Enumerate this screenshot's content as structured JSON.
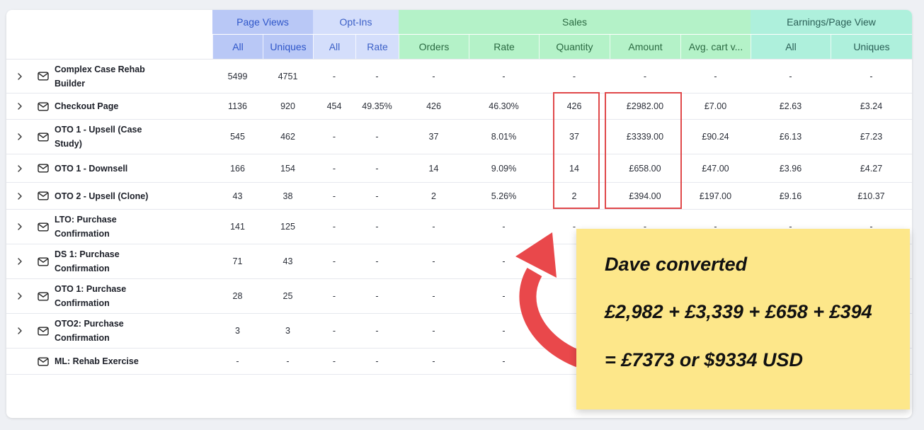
{
  "header": {
    "groups": [
      {
        "label": "Page Views",
        "subs": [
          "All",
          "Uniques"
        ]
      },
      {
        "label": "Opt-Ins",
        "subs": [
          "All",
          "Rate"
        ]
      },
      {
        "label": "Sales",
        "subs": [
          "Orders",
          "Rate",
          "Quantity",
          "Amount",
          "Avg. cart v..."
        ]
      },
      {
        "label": "Earnings/Page View",
        "subs": [
          "All",
          "Uniques"
        ]
      }
    ]
  },
  "rows": [
    {
      "name_lines": [
        "Complex Case Rehab",
        "Builder"
      ],
      "expandable": true,
      "cells": [
        "5499",
        "4751",
        "-",
        "-",
        "-",
        "-",
        "-",
        "-",
        "-",
        "-",
        "-"
      ]
    },
    {
      "name_lines": [
        "Checkout Page"
      ],
      "expandable": true,
      "cells": [
        "1136",
        "920",
        "454",
        "49.35%",
        "426",
        "46.30%",
        "426",
        "£2982.00",
        "£7.00",
        "£2.63",
        "£3.24"
      ]
    },
    {
      "name_lines": [
        "OTO 1 - Upsell (Case",
        "Study)"
      ],
      "expandable": true,
      "cells": [
        "545",
        "462",
        "-",
        "-",
        "37",
        "8.01%",
        "37",
        "£3339.00",
        "£90.24",
        "£6.13",
        "£7.23"
      ]
    },
    {
      "name_lines": [
        "OTO 1 - Downsell"
      ],
      "expandable": true,
      "cells": [
        "166",
        "154",
        "-",
        "-",
        "14",
        "9.09%",
        "14",
        "£658.00",
        "£47.00",
        "£3.96",
        "£4.27"
      ]
    },
    {
      "name_lines": [
        "OTO 2 - Upsell (Clone)"
      ],
      "expandable": true,
      "cells": [
        "43",
        "38",
        "-",
        "-",
        "2",
        "5.26%",
        "2",
        "£394.00",
        "£197.00",
        "£9.16",
        "£10.37"
      ]
    },
    {
      "name_lines": [
        "LTO: Purchase",
        "Confirmation"
      ],
      "expandable": true,
      "cells": [
        "141",
        "125",
        "-",
        "-",
        "-",
        "-",
        "-",
        "-",
        "-",
        "-",
        "-"
      ]
    },
    {
      "name_lines": [
        "DS 1: Purchase",
        "Confirmation"
      ],
      "expandable": true,
      "cells": [
        "71",
        "43",
        "-",
        "-",
        "-",
        "-",
        "",
        "",
        "",
        "",
        ""
      ]
    },
    {
      "name_lines": [
        "OTO 1: Purchase",
        "Confirmation"
      ],
      "expandable": true,
      "cells": [
        "28",
        "25",
        "-",
        "-",
        "-",
        "-",
        "",
        "",
        "",
        "",
        ""
      ]
    },
    {
      "name_lines": [
        "OTO2: Purchase",
        "Confirmation"
      ],
      "expandable": true,
      "cells": [
        "3",
        "3",
        "-",
        "-",
        "-",
        "-",
        "",
        "",
        "",
        "",
        ""
      ]
    },
    {
      "name_lines": [
        "ML: Rehab Exercise"
      ],
      "expandable": false,
      "cells": [
        "-",
        "-",
        "-",
        "-",
        "-",
        "-",
        "",
        "",
        "",
        "",
        ""
      ]
    }
  ],
  "annotation": {
    "line1": "Dave converted",
    "line2": "£2,982 + £3,339 + £658 + £394",
    "line3": "= £7373 or $9334 USD"
  },
  "colors": {
    "page_views": "#b9c8f6",
    "opt_ins": "#d4defb",
    "sales": "#b4f2c8",
    "earnings": "#aef0dc",
    "highlight": "#e0484a",
    "note": "#fde78a"
  },
  "icons": {
    "expand": "chevron-right-icon",
    "row": "mail-icon",
    "arrow": "curved-arrow-icon"
  }
}
